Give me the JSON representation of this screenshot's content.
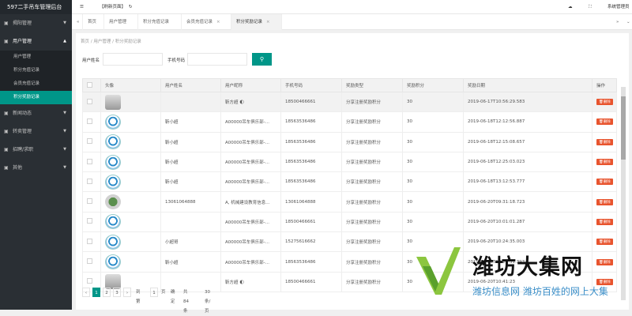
{
  "app": {
    "title": "597二手吊车管理后台"
  },
  "sidebar": {
    "items": [
      {
        "label": "揭阳管理",
        "icon": "monitor-icon",
        "arrow": "▼"
      },
      {
        "label": "用户管理",
        "icon": "user-icon",
        "arrow": "▲"
      },
      {
        "label": "新闻动态",
        "icon": "news-icon",
        "arrow": "▼"
      },
      {
        "label": "转卖管理",
        "icon": "transfer-icon",
        "arrow": "▼"
      },
      {
        "label": "招聘/求职",
        "icon": "job-icon",
        "arrow": "▼"
      },
      {
        "label": "其他",
        "icon": "other-icon",
        "arrow": "▼"
      }
    ],
    "subitems": [
      "用户管理",
      "积分充值记录",
      "会员充值记录",
      "积分奖励记录"
    ]
  },
  "topbar": {
    "refresh": "【刷新页面】",
    "user": "系统管理员"
  },
  "tabs": [
    {
      "label": "首页"
    },
    {
      "label": "用户管理"
    },
    {
      "label": "积分充值记录"
    },
    {
      "label": "会员充值记录"
    },
    {
      "label": "积分奖励记录"
    }
  ],
  "breadcrumb": "首页 / 用户管理 / 积分奖励记录",
  "filter": {
    "name_label": "用户姓名",
    "phone_label": "手机号码"
  },
  "table": {
    "headers": [
      "头像",
      "用户姓名",
      "用户昵称",
      "手机号码",
      "奖励类型",
      "奖励积分",
      "奖励日期",
      "操作"
    ],
    "rows": [
      {
        "avatar": "car",
        "name": "",
        "nick": "靳方超 🌓",
        "phone": "18500466661",
        "type": "分享注册奖励积分",
        "points": "30",
        "date": "2019-06-17T10:56:29.583"
      },
      {
        "avatar": "ok",
        "name": "靳小超",
        "nick": "A00000吊车俱乐部-...",
        "phone": "18563536486",
        "type": "分享注册奖励积分",
        "points": "30",
        "date": "2019-06-18T12:12:56.887"
      },
      {
        "avatar": "ok",
        "name": "靳小超",
        "nick": "A00000吊车俱乐部-...",
        "phone": "18563536486",
        "type": "分享注册奖励积分",
        "points": "30",
        "date": "2019-06-18T12:15:08.657"
      },
      {
        "avatar": "ok",
        "name": "靳小超",
        "nick": "A00000吊车俱乐部-...",
        "phone": "18563536486",
        "type": "分享注册奖励积分",
        "points": "30",
        "date": "2019-06-18T12:25:03.023"
      },
      {
        "avatar": "ok",
        "name": "靳小超",
        "nick": "A00000吊车俱乐部-...",
        "phone": "18563536486",
        "type": "分享注册奖励积分",
        "points": "30",
        "date": "2019-06-18T13:12:53.777"
      },
      {
        "avatar": "dot",
        "name": "13061064888",
        "nick": "A, 机械建设教育信息...",
        "phone": "13061064888",
        "type": "分享注册奖励积分",
        "points": "30",
        "date": "2019-06-20T09:31:18.723"
      },
      {
        "avatar": "ok",
        "name": "",
        "nick": "A00000吊车俱乐部-...",
        "phone": "18500466661",
        "type": "分享注册奖励积分",
        "points": "30",
        "date": "2019-06-20T10:01:01.287"
      },
      {
        "avatar": "ok",
        "name": "小超哥",
        "nick": "A00000吊车俱乐部-...",
        "phone": "15275616662",
        "type": "分享注册奖励积分",
        "points": "30",
        "date": "2019-06-20T10:24:35.003"
      },
      {
        "avatar": "ok",
        "name": "靳小超",
        "nick": "A00000吊车俱乐部-...",
        "phone": "18563536486",
        "type": "分享注册奖励积分",
        "points": "30",
        "date": "2019-06-20T10:21:31.393"
      },
      {
        "avatar": "car",
        "name": "",
        "nick": "靳方超 🌓",
        "phone": "18500466661",
        "type": "分享注册奖励积分",
        "points": "30",
        "date": "2019-06-20T10:41:23"
      }
    ],
    "delete_label": "删除"
  },
  "pager": {
    "pages": [
      "1",
      "2",
      "3"
    ],
    "prev": "‹",
    "next": "›",
    "goto_label": "到第",
    "page_input": "1",
    "page_unit": "页",
    "confirm": "确定",
    "total": "共 84 条",
    "per_page": "30 条/页"
  },
  "watermark": {
    "title": "潍坊大集网",
    "subtitle": "潍坊信息网 潍坊百姓的网上大集"
  }
}
